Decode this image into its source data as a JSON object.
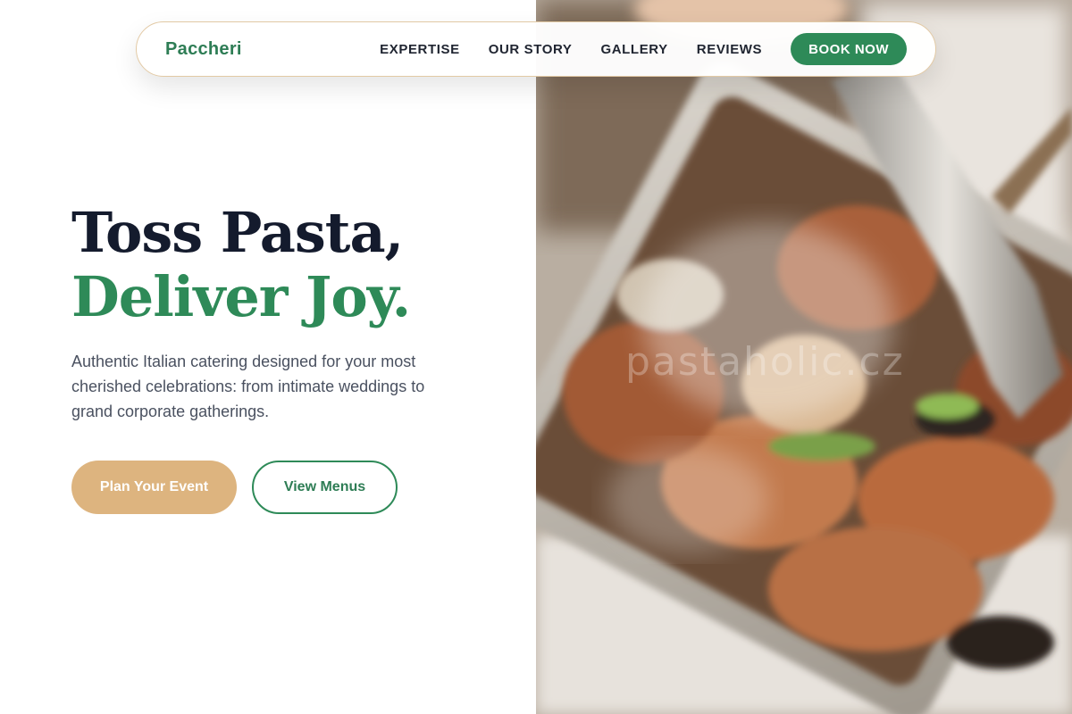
{
  "nav": {
    "brand": "Paccheri",
    "links": [
      "EXPERTISE",
      "OUR STORY",
      "GALLERY",
      "REVIEWS"
    ],
    "cta": "BOOK NOW"
  },
  "hero": {
    "headline_line1": "Toss Pasta,",
    "headline_line2": "Deliver Joy.",
    "description": "Authentic Italian catering designed for your most cherished celebrations: from intimate weddings to grand corporate gatherings.",
    "primary_cta": "Plan Your Event",
    "secondary_cta": "View Menus"
  },
  "image": {
    "watermark": "pastaholic.cz",
    "alt": "food-photo"
  },
  "colors": {
    "brand_green": "#2e8a58",
    "headline_dark": "#141b2d",
    "accent_tan": "#ddb47f",
    "nav_border": "#e2c9a4"
  }
}
